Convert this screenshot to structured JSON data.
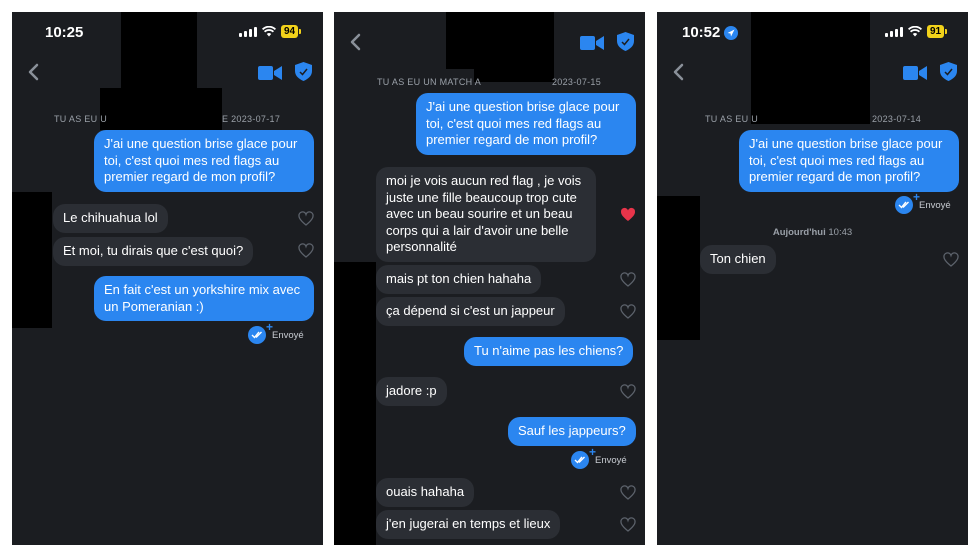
{
  "screens": [
    {
      "status": {
        "time": "10:25",
        "battery": "94"
      },
      "match_banner": {
        "left": "TU AS EU U",
        "right": "E 2023-07-17"
      },
      "messages": [
        {
          "dir": "out",
          "text": "J'ai une question brise glace pour toi, c'est quoi mes red flags au premier regard de mon profil?"
        },
        {
          "dir": "in",
          "text": "Le chihuahua lol",
          "liked": false
        },
        {
          "dir": "in",
          "text": "Et moi, tu dirais que c'est quoi?",
          "liked": false
        },
        {
          "dir": "out",
          "text": "En fait c'est un yorkshire mix avec un Pomeranian :)"
        }
      ],
      "sent_label": "Envoyé"
    },
    {
      "status": {
        "time": "",
        "battery": ""
      },
      "match_banner": {
        "left": "TU AS EU UN MATCH A",
        "right": "2023-07-15"
      },
      "messages": [
        {
          "dir": "out",
          "text": "J'ai une question brise glace pour toi, c'est quoi mes red flags au premier regard de mon profil?"
        },
        {
          "dir": "in",
          "text": "moi je vois aucun red flag , je vois juste une fille beaucoup trop cute avec un beau sourire et un beau corps qui a lair d'avoir une belle personnalité",
          "liked": true
        },
        {
          "dir": "in",
          "text": "mais pt ton chien hahaha",
          "liked": false
        },
        {
          "dir": "in",
          "text": "ça dépend si c'est un jappeur",
          "liked": false
        },
        {
          "dir": "out",
          "text": "Tu n'aime pas les chiens?"
        },
        {
          "dir": "in",
          "text": "jadore :p",
          "liked": false
        },
        {
          "dir": "out",
          "text": "Sauf les jappeurs?"
        },
        {
          "dir": "in",
          "text": "ouais hahaha",
          "liked": false
        },
        {
          "dir": "in",
          "text": "j'en jugerai en temps et lieux",
          "liked": false
        }
      ],
      "sent_label": "Envoyé"
    },
    {
      "status": {
        "time": "10:52",
        "battery": "91"
      },
      "match_banner": {
        "left": "TU AS EU U",
        "right": "2023-07-14"
      },
      "messages": [
        {
          "dir": "out",
          "text": "J'ai une question brise glace pour toi, c'est quoi mes red flags au premier regard de mon profil?"
        },
        {
          "dir": "in",
          "text": "Ton chien",
          "liked": false
        }
      ],
      "sent_label": "Envoyé",
      "date_separator": {
        "day": "Aujourd'hui",
        "time": "10:43"
      }
    }
  ],
  "colors": {
    "outgoing": "#2b86f0",
    "incoming": "#2b2e34",
    "background": "#1b1d21",
    "heart_liked": "#e8344a",
    "battery": "#f2d21a"
  },
  "icons": [
    "chevron-left-icon",
    "video-camera-icon",
    "shield-icon",
    "heart-icon",
    "double-check-icon",
    "location-arrow-icon",
    "signal-icon",
    "wifi-icon",
    "battery-icon"
  ]
}
